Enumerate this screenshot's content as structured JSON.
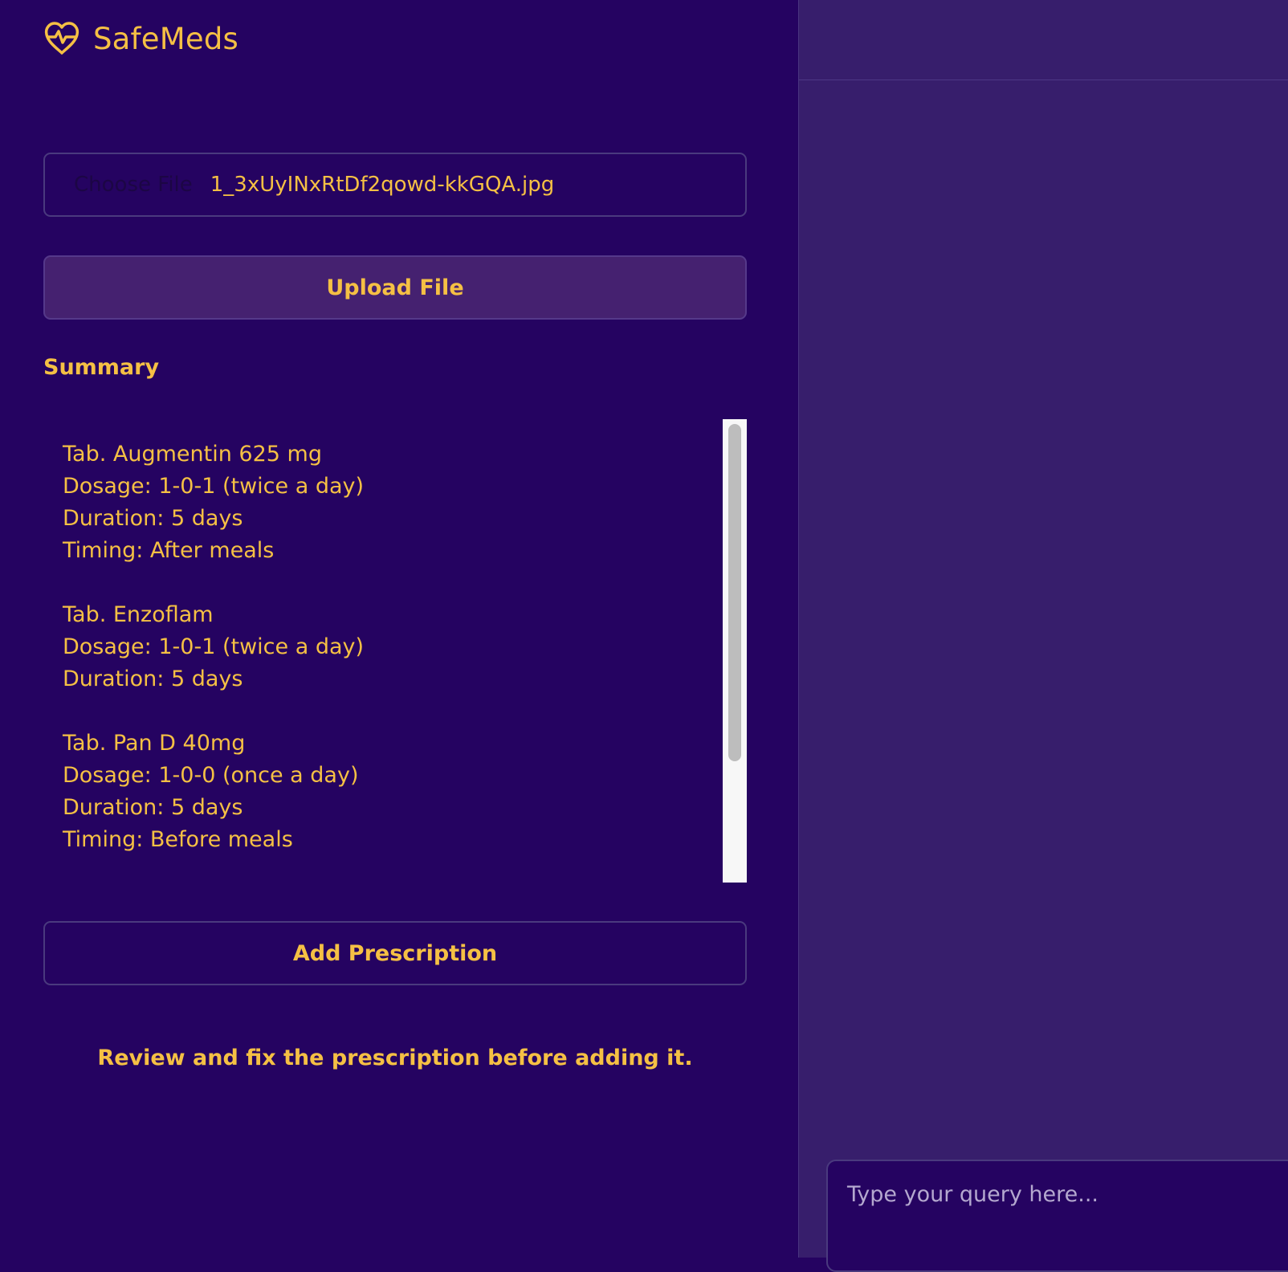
{
  "brand": {
    "name": "SafeMeds",
    "icon": "heart-pulse-icon"
  },
  "upload": {
    "choose_label": "Choose File",
    "file_name": "1_3xUyINxRtDf2qowd-kkGQA.jpg",
    "upload_label": "Upload File"
  },
  "summary": {
    "label": "Summary",
    "medications": [
      {
        "name": "Tab. Augmentin 625 mg",
        "dosage": "Dosage: 1-0-1 (twice a day)",
        "duration": "Duration: 5 days",
        "timing": "Timing: After meals"
      },
      {
        "name": "Tab. Enzoflam",
        "dosage": "Dosage: 1-0-1 (twice a day)",
        "duration": "Duration: 5 days"
      },
      {
        "name": "Tab. Pan D 40mg",
        "dosage": "Dosage: 1-0-0 (once a day)",
        "duration": "Duration: 5 days",
        "timing": "Timing: Before meals"
      }
    ]
  },
  "actions": {
    "add_label": "Add Prescription",
    "notice": "Review and fix the prescription before adding it."
  },
  "chat": {
    "placeholder": "Type your query here..."
  },
  "colors": {
    "background": "#250361",
    "panel": "#371e6c",
    "accent": "#f5c044"
  }
}
